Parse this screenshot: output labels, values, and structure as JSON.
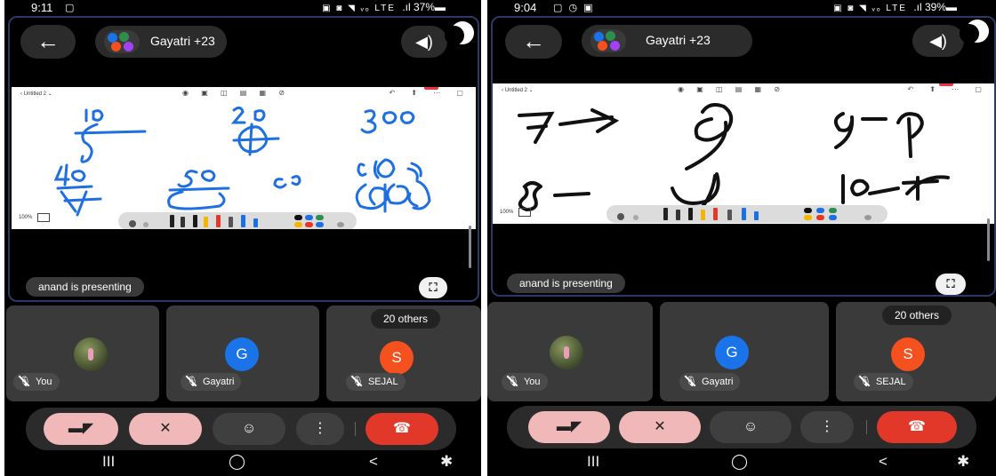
{
  "screens": [
    {
      "status": {
        "time": "9:11",
        "left_icons": "▢",
        "right_symbols": "▣ ◙ ◥ ᵥₒ LTE",
        "battery": ".ıl 37%▬"
      },
      "header": {
        "back_icon": "arrow-left-icon",
        "title": "Gayatri +23",
        "speaker_icon": "speaker-icon"
      },
      "whiteboard": {
        "doc_title": "‹   Untitled 2 ⌄",
        "tools": "◉ ▣ ◫ ▤ ▦ ⊘",
        "right_tools": "↶ ⬆ ⋯ ▢",
        "zoom": "100%"
      },
      "presenting_label": "anand is presenting",
      "fullscreen_icon": "⛶",
      "others_label": "20 others",
      "participants": [
        {
          "name": "You",
          "avatar_letter": "",
          "avatar_color": ""
        },
        {
          "name": "Gayatri",
          "avatar_letter": "G",
          "avatar_color": "#1a73e8"
        },
        {
          "name": "SEJAL",
          "avatar_letter": "S",
          "avatar_color": "#f4511e"
        }
      ],
      "controls": {
        "camera_icon": "camera-off-icon",
        "mic_icon": "mic-off-icon",
        "reaction_icon": "emoji-icon",
        "more_icon": "more-vert-icon",
        "hangup_icon": "end-call-icon"
      },
      "nav": {
        "recents": "III",
        "home": "◯",
        "back": "<",
        "accessibility": "✱"
      }
    },
    {
      "status": {
        "time": "9:04",
        "left_icons": "▢ ◷ ▣",
        "right_symbols": "▣ ◙ ◥ ᵥₒ LTE",
        "battery": ".ıl 39%▬"
      },
      "header": {
        "back_icon": "arrow-left-icon",
        "title": "Gayatri +23",
        "speaker_icon": "speaker-icon"
      },
      "whiteboard": {
        "doc_title": "‹   Untitled 2 ⌄",
        "tools": "◉ ▣ ◫ ▤ ▦ ⊘",
        "right_tools": "↶ ⬆ ⋯ ▢",
        "zoom": "100%"
      },
      "presenting_label": "anand is presenting",
      "fullscreen_icon": "⛶",
      "others_label": "20 others",
      "participants": [
        {
          "name": "You",
          "avatar_letter": "",
          "avatar_color": ""
        },
        {
          "name": "Gayatri",
          "avatar_letter": "G",
          "avatar_color": "#1a73e8"
        },
        {
          "name": "SEJAL",
          "avatar_letter": "S",
          "avatar_color": "#f4511e"
        }
      ],
      "controls": {
        "camera_icon": "camera-off-icon",
        "mic_icon": "mic-off-icon",
        "reaction_icon": "emoji-icon",
        "more_icon": "more-vert-icon",
        "hangup_icon": "end-call-icon"
      },
      "nav": {
        "recents": "III",
        "home": "◯",
        "back": "<",
        "accessibility": "✱"
      }
    }
  ],
  "colors": {
    "hangup": "#e2382a",
    "muted_control": "#f0b8b8",
    "tile_bg": "#3a3a3a",
    "bar_bg": "#2b2b2b",
    "frame_border": "#2a3a66",
    "ink_blue": "#1e6fe0",
    "ink_black": "#111111"
  }
}
